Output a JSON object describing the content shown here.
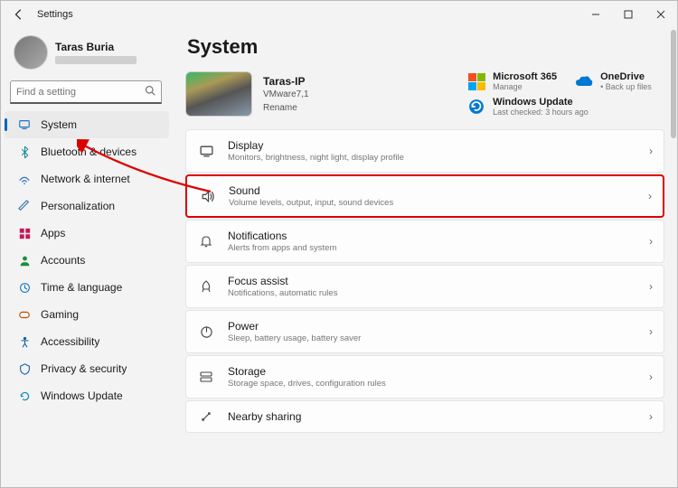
{
  "window": {
    "title": "Settings"
  },
  "user": {
    "name": "Taras Buria"
  },
  "search": {
    "placeholder": "Find a setting"
  },
  "sidebar": {
    "items": [
      {
        "label": "System"
      },
      {
        "label": "Bluetooth & devices"
      },
      {
        "label": "Network & internet"
      },
      {
        "label": "Personalization"
      },
      {
        "label": "Apps"
      },
      {
        "label": "Accounts"
      },
      {
        "label": "Time & language"
      },
      {
        "label": "Gaming"
      },
      {
        "label": "Accessibility"
      },
      {
        "label": "Privacy & security"
      },
      {
        "label": "Windows Update"
      }
    ]
  },
  "main": {
    "title": "System",
    "device": {
      "name": "Taras-IP",
      "model": "VMware7,1",
      "rename": "Rename"
    },
    "cards": {
      "m365": {
        "title": "Microsoft 365",
        "sub": "Manage"
      },
      "onedrive": {
        "title": "OneDrive",
        "sub": "• Back up files"
      },
      "update": {
        "title": "Windows Update",
        "sub": "Last checked: 3 hours ago"
      }
    },
    "settings": [
      {
        "title": "Display",
        "desc": "Monitors, brightness, night light, display profile"
      },
      {
        "title": "Sound",
        "desc": "Volume levels, output, input, sound devices"
      },
      {
        "title": "Notifications",
        "desc": "Alerts from apps and system"
      },
      {
        "title": "Focus assist",
        "desc": "Notifications, automatic rules"
      },
      {
        "title": "Power",
        "desc": "Sleep, battery usage, battery saver"
      },
      {
        "title": "Storage",
        "desc": "Storage space, drives, configuration rules"
      },
      {
        "title": "Nearby sharing",
        "desc": ""
      }
    ]
  }
}
